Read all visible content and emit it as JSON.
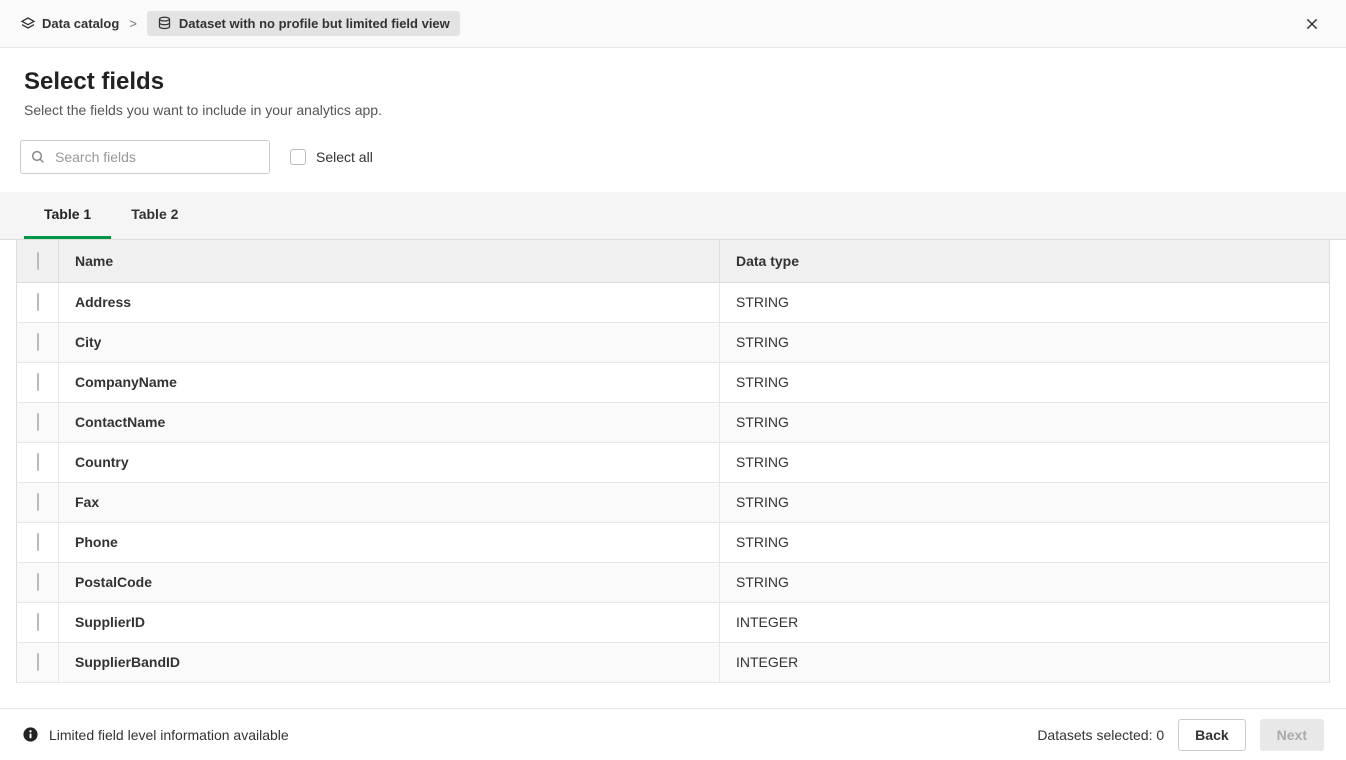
{
  "breadcrumb": {
    "root": "Data catalog",
    "separator": ">",
    "current": "Dataset with no profile but limited field view"
  },
  "header": {
    "title": "Select fields",
    "subtitle": "Select the fields you want to include in your analytics app."
  },
  "search": {
    "placeholder": "Search fields"
  },
  "select_all": {
    "label": "Select all"
  },
  "tabs": [
    {
      "label": "Table 1",
      "active": true
    },
    {
      "label": "Table 2",
      "active": false
    }
  ],
  "table": {
    "columns": {
      "name": "Name",
      "type": "Data type"
    },
    "rows": [
      {
        "name": "Address",
        "type": "STRING"
      },
      {
        "name": "City",
        "type": "STRING"
      },
      {
        "name": "CompanyName",
        "type": "STRING"
      },
      {
        "name": "ContactName",
        "type": "STRING"
      },
      {
        "name": "Country",
        "type": "STRING"
      },
      {
        "name": "Fax",
        "type": "STRING"
      },
      {
        "name": "Phone",
        "type": "STRING"
      },
      {
        "name": "PostalCode",
        "type": "STRING"
      },
      {
        "name": "SupplierID",
        "type": "INTEGER"
      },
      {
        "name": "SupplierBandID",
        "type": "INTEGER"
      }
    ]
  },
  "footer": {
    "info": "Limited field level information available",
    "status_prefix": "Datasets selected: ",
    "status_count": "0",
    "back": "Back",
    "next": "Next"
  }
}
